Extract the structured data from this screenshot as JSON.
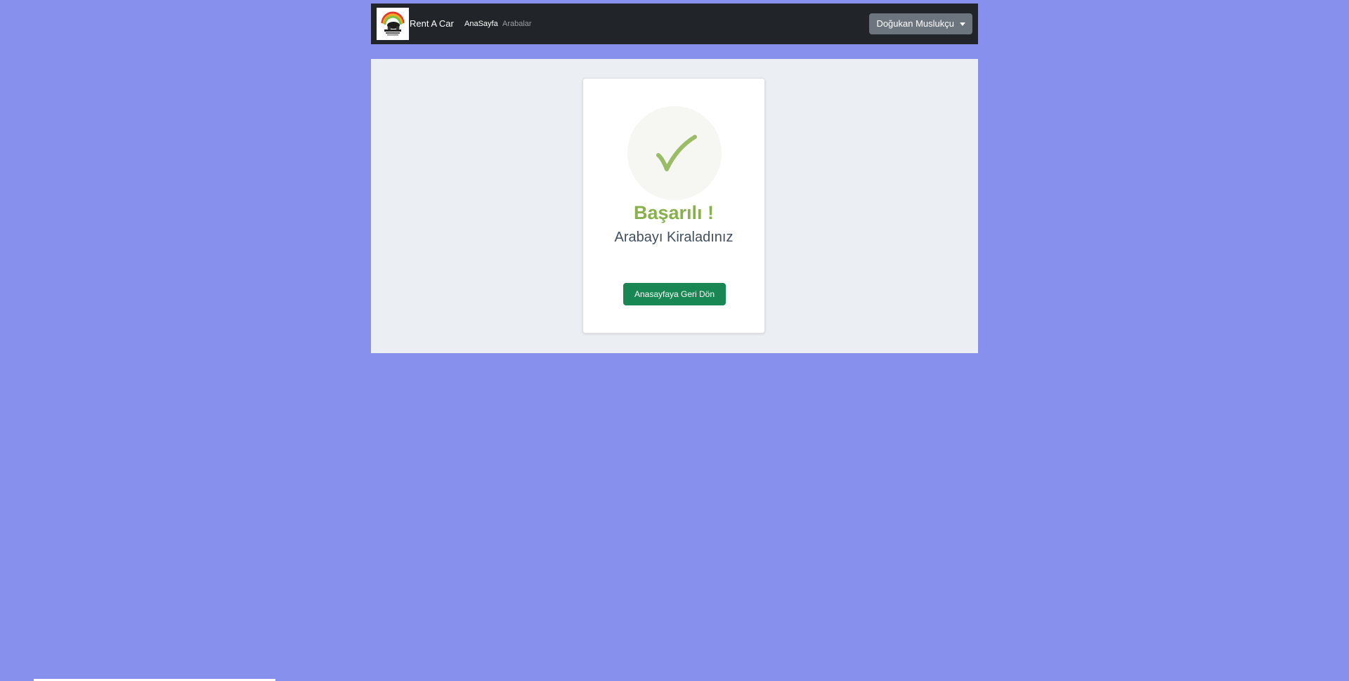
{
  "navbar": {
    "brand_label": "Rent A Car",
    "logo_icon": "rentacar-logo",
    "links": [
      {
        "label": "AnaSayfa",
        "active": true
      },
      {
        "label": "Arabalar",
        "active": false
      }
    ],
    "user_menu_label": "Doğukan Muslukçu"
  },
  "card": {
    "icon": "checkmark-icon",
    "title": "Başarılı !",
    "message": "Arabayı Kiraladınız",
    "button_label": "Anasayfaya Geri Dön"
  },
  "colors": {
    "page_background": "#8890ee",
    "navbar_background": "#212529",
    "content_background": "#ebeff3",
    "success_green": "#88b04b",
    "button_green": "#198754"
  }
}
